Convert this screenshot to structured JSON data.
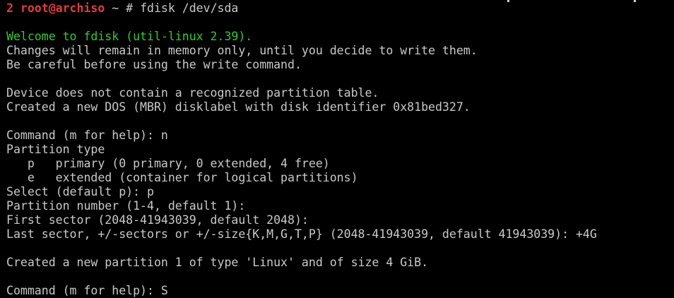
{
  "prompt": {
    "exit_code": "2",
    "user_host": "root@archiso",
    "path_and_symbol": " ~ # ",
    "command": "fdisk /dev/sda"
  },
  "output": {
    "welcome": "Welcome to fdisk (util-linux 2.39).",
    "memory_notice": "Changes will remain in memory only, until you decide to write them.",
    "careful_notice": "Be careful before using the write command.",
    "no_partition_table": "Device does not contain a recognized partition table.",
    "created_label": "Created a new DOS (MBR) disklabel with disk identifier 0x81bed327.",
    "command_prompt_1": "Command (m for help): n",
    "partition_type_header": "Partition type",
    "option_primary": "   p   primary (0 primary, 0 extended, 4 free)",
    "option_extended": "   e   extended (container for logical partitions)",
    "select_prompt": "Select (default p): p",
    "partition_number_prompt": "Partition number (1-4, default 1):",
    "first_sector_prompt": "First sector (2048-41943039, default 2048):",
    "last_sector_prompt": "Last sector, +/-sectors or +/-size{K,M,G,T,P} (2048-41943039, default 41943039): +4G",
    "created_partition": "Created a new partition 1 of type 'Linux' and of size 4 GiB.",
    "command_prompt_2": "Command (m for help): S"
  },
  "colors": {
    "background": "#000000",
    "text": "#c9c9c9",
    "prompt_red": "#e23b3b",
    "welcome_green": "#2fcc2f"
  }
}
